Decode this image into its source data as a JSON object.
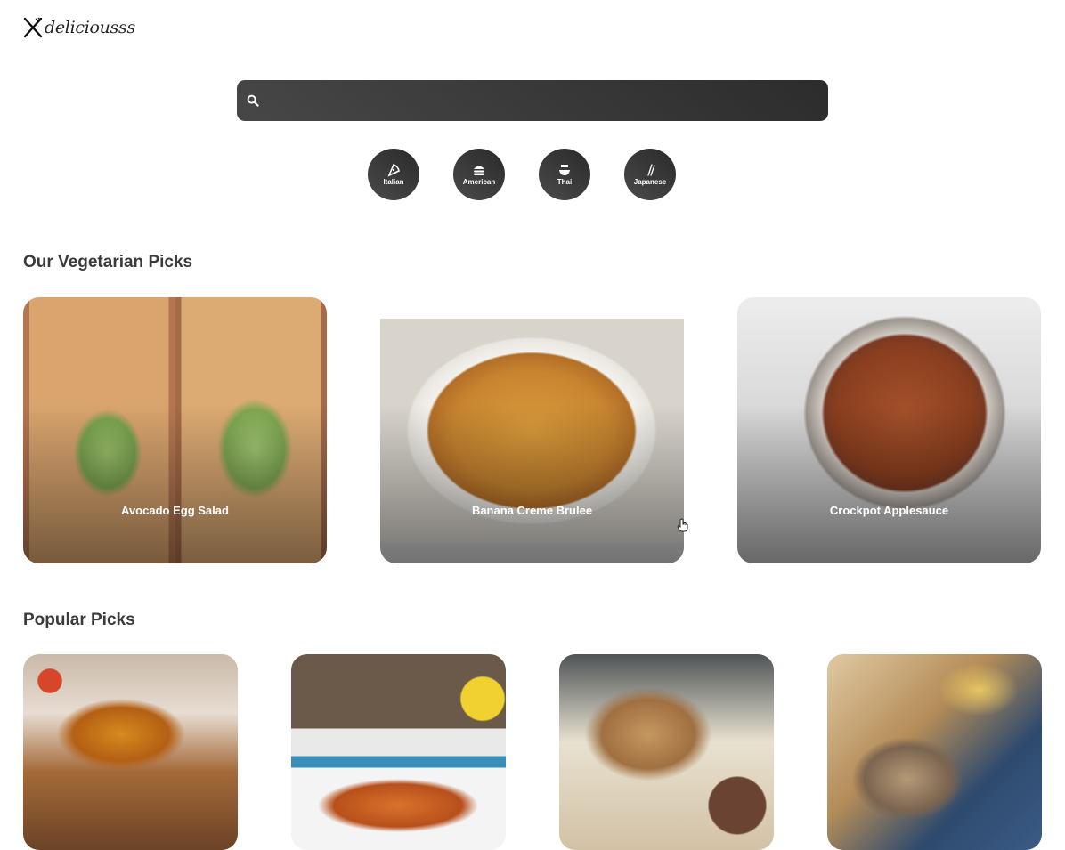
{
  "brand": {
    "name": "deliciousss"
  },
  "search": {
    "value": "",
    "placeholder": ""
  },
  "cuisines": [
    {
      "label": "Italian",
      "icon": "pizza-icon"
    },
    {
      "label": "American",
      "icon": "burger-icon"
    },
    {
      "label": "Thai",
      "icon": "bowl-icon"
    },
    {
      "label": "Japanese",
      "icon": "chopsticks-icon"
    }
  ],
  "vegetarian": {
    "title": "Our Vegetarian Picks",
    "recipes": [
      {
        "title": "Avocado Egg Salad"
      },
      {
        "title": "Banana Creme Brulee"
      },
      {
        "title": "Crockpot Applesauce"
      }
    ]
  },
  "popular": {
    "title": "Popular Picks",
    "recipes": [
      {
        "title": ""
      },
      {
        "title": ""
      },
      {
        "title": ""
      },
      {
        "title": ""
      }
    ]
  }
}
